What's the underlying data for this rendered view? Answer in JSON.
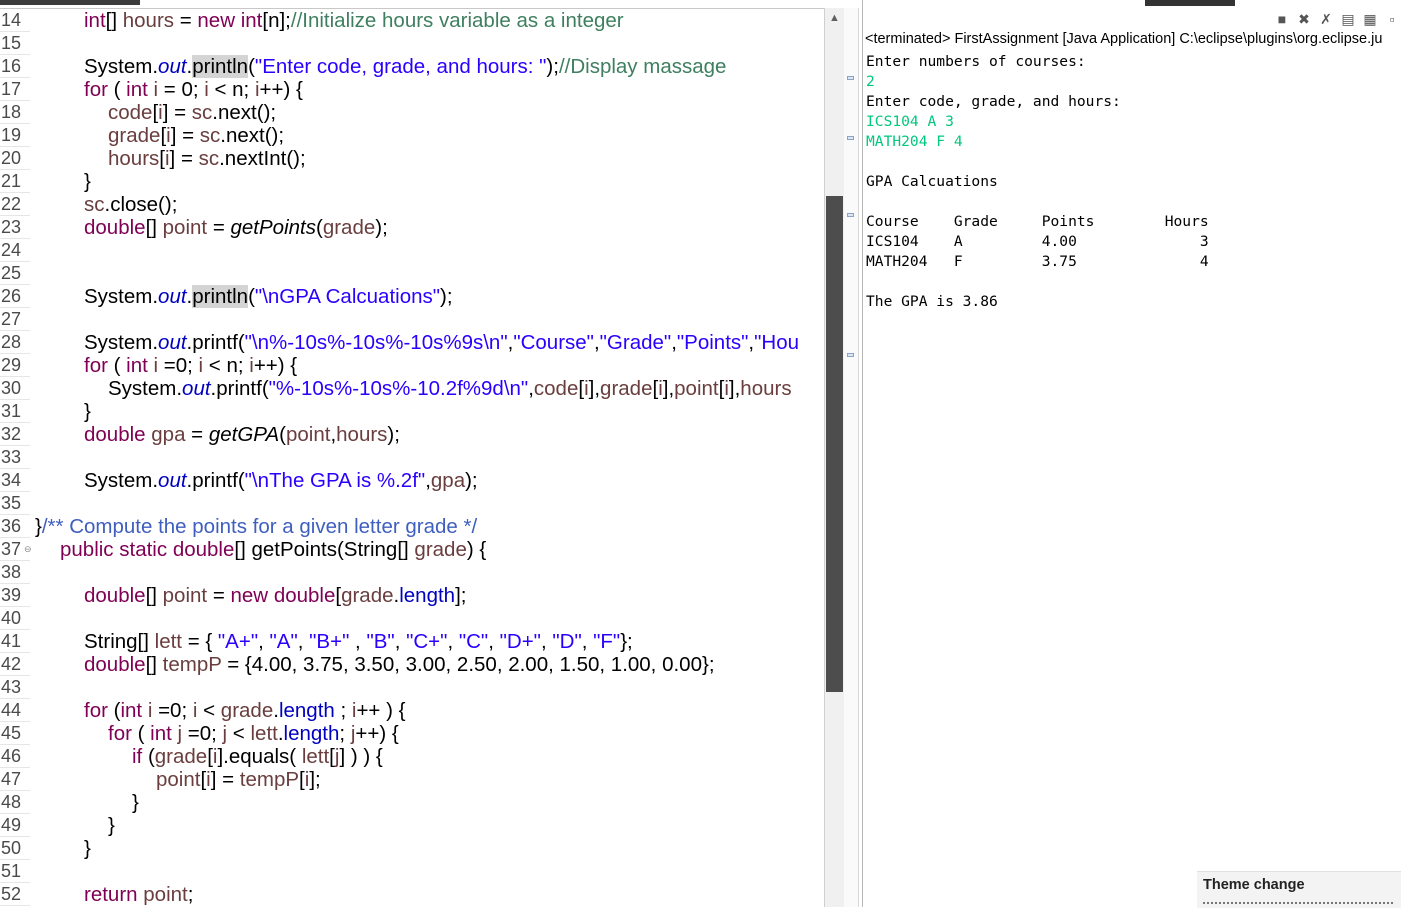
{
  "editor": {
    "lines": [
      {
        "n": "14",
        "code": "<span class=\"kw\">int</span>[] <span class=\"var\">hours</span> = <span class=\"kw\">new</span> <span class=\"kw\">int</span>[n];<span class=\"cm\">//Initialize hours variable as a integer</span>"
      },
      {
        "n": "15",
        "code": ""
      },
      {
        "n": "16",
        "code": "System.<span class=\"st\">out</span>.<span class=\"hl\">println</span>(<span class=\"str\">\"Enter code, grade, and hours: \"</span>);<span class=\"cm\">//Display massage</span>"
      },
      {
        "n": "17",
        "code": "<span class=\"kw\">for</span> ( <span class=\"kw\">int</span> <span class=\"var\">i</span> = 0; <span class=\"var\">i</span> &lt; n; <span class=\"var\">i</span>++) {"
      },
      {
        "n": "18",
        "indent": 1,
        "code": "<span class=\"var\">code</span>[<span class=\"var\">i</span>] = <span class=\"var\">sc</span>.next();"
      },
      {
        "n": "19",
        "indent": 1,
        "code": "<span class=\"var\">grade</span>[<span class=\"var\">i</span>] = <span class=\"var\">sc</span>.next();"
      },
      {
        "n": "20",
        "indent": 1,
        "code": "<span class=\"var\">hours</span>[<span class=\"var\">i</span>] = <span class=\"var\">sc</span>.nextInt();"
      },
      {
        "n": "21",
        "code": "}"
      },
      {
        "n": "22",
        "code": "<span class=\"var\">sc</span>.close();"
      },
      {
        "n": "23",
        "code": "<span class=\"kw\">double</span>[] <span class=\"var\">point</span> = <span class=\"mi\">getPoints</span>(<span class=\"var\">grade</span>);"
      },
      {
        "n": "24",
        "code": ""
      },
      {
        "n": "25",
        "code": ""
      },
      {
        "n": "26",
        "code": "System.<span class=\"st\">out</span>.<span class=\"hl\">println</span>(<span class=\"str\">\"\\nGPA Calcuations\"</span>);"
      },
      {
        "n": "27",
        "code": ""
      },
      {
        "n": "28",
        "code": "System.<span class=\"st\">out</span>.printf(<span class=\"str\">\"\\n%-10s%-10s%-10s%9s\\n\"</span>,<span class=\"str\">\"Course\"</span>,<span class=\"str\">\"Grade\"</span>,<span class=\"str\">\"Points\"</span>,<span class=\"str\">\"Hou</span>"
      },
      {
        "n": "29",
        "code": "<span class=\"kw\">for</span> ( <span class=\"kw\">int</span> <span class=\"var\">i</span> =0; <span class=\"var\">i</span> &lt; n; <span class=\"var\">i</span>++) {"
      },
      {
        "n": "30",
        "indent": 1,
        "code": "System.<span class=\"st\">out</span>.printf(<span class=\"str\">\"%-10s%-10s%-10.2f%9d\\n\"</span>,<span class=\"var\">code</span>[<span class=\"var\">i</span>],<span class=\"var\">grade</span>[<span class=\"var\">i</span>],<span class=\"var\">point</span>[<span class=\"var\">i</span>],<span class=\"var\">hours</span>"
      },
      {
        "n": "31",
        "code": "}"
      },
      {
        "n": "32",
        "code": "<span class=\"kw\">double</span> <span class=\"var\">gpa</span> = <span class=\"mi\">getGPA</span>(<span class=\"var\">point</span>,<span class=\"var\">hours</span>);"
      },
      {
        "n": "33",
        "code": ""
      },
      {
        "n": "34",
        "code": "System.<span class=\"st\">out</span>.printf(<span class=\"str\">\"\\nThe GPA is %.2f\"</span>,<span class=\"var\">gpa</span>);"
      },
      {
        "n": "35",
        "code": ""
      },
      {
        "n": "36",
        "outdent": true,
        "code": "}<span class=\"jd\">/** Compute the points for a given letter grade */</span>"
      },
      {
        "n": "37",
        "fold": true,
        "code": "<span class=\"kw\">public</span> <span class=\"kw\">static</span> <span class=\"kw\">double</span>[] getPoints(String[] <span class=\"var\">grade</span>) {",
        "indent": -1
      },
      {
        "n": "38",
        "code": ""
      },
      {
        "n": "39",
        "code": "<span class=\"kw\">double</span>[] <span class=\"var\">point</span> = <span class=\"kw\">new</span> <span class=\"kw\">double</span>[<span class=\"var\">grade</span>.<span class=\"fld\">length</span>];"
      },
      {
        "n": "40",
        "code": ""
      },
      {
        "n": "41",
        "code": "String[] <span class=\"var\">lett</span> = { <span class=\"str\">\"A+\"</span>, <span class=\"str\">\"A\"</span>, <span class=\"str\">\"B+\"</span> , <span class=\"str\">\"B\"</span>, <span class=\"str\">\"C+\"</span>, <span class=\"str\">\"C\"</span>, <span class=\"str\">\"D+\"</span>, <span class=\"str\">\"D\"</span>, <span class=\"str\">\"F\"</span>};"
      },
      {
        "n": "42",
        "code": "<span class=\"kw\">double</span>[] <span class=\"var\">tempP</span> = {4.00, 3.75, 3.50, 3.00, 2.50, 2.00, 1.50, 1.00, 0.00};"
      },
      {
        "n": "43",
        "code": ""
      },
      {
        "n": "44",
        "code": "<span class=\"kw\">for</span> (<span class=\"kw\">int</span> <span class=\"var\">i</span> =0; <span class=\"var\">i</span> &lt; <span class=\"var\">grade</span>.<span class=\"fld\">length</span> ; <span class=\"var\">i</span>++ ) {"
      },
      {
        "n": "45",
        "indent": 1,
        "code": "<span class=\"kw\">for</span> ( <span class=\"kw\">int</span> <span class=\"var\">j</span> =0; <span class=\"var\">j</span> &lt; <span class=\"var\">lett</span>.<span class=\"fld\">length</span>; <span class=\"var\">j</span>++) {"
      },
      {
        "n": "46",
        "indent": 2,
        "code": "<span class=\"kw\">if</span> (<span class=\"var\">grade</span>[<span class=\"var\">i</span>].equals( <span class=\"var\">lett</span>[<span class=\"var\">j</span>] ) ) {"
      },
      {
        "n": "47",
        "indent": 3,
        "code": "<span class=\"var\">point</span>[<span class=\"var\">i</span>] = <span class=\"var\">tempP</span>[<span class=\"var\">i</span>];"
      },
      {
        "n": "48",
        "indent": 2,
        "code": "}"
      },
      {
        "n": "49",
        "indent": 1,
        "code": "}"
      },
      {
        "n": "50",
        "code": "}"
      },
      {
        "n": "51",
        "code": ""
      },
      {
        "n": "52",
        "code": "<span class=\"kw\">return</span> <span class=\"var\">point</span>;"
      }
    ]
  },
  "console": {
    "title": "<terminated> FirstAssignment [Java Application] C:\\eclipse\\plugins\\org.eclipse.ju",
    "toolbar_icons": [
      "terminate-icon",
      "remove-launch-icon",
      "remove-all-icon",
      "pin-console-icon",
      "display-selected-console-icon",
      "open-console-icon"
    ],
    "output": [
      {
        "text": "Enter numbers of courses:",
        "input": false
      },
      {
        "text": "2",
        "input": true
      },
      {
        "text": "Enter code, grade, and hours:",
        "input": false
      },
      {
        "text": "ICS104 A 3",
        "input": true
      },
      {
        "text": "MATH204 F 4",
        "input": true
      },
      {
        "text": "",
        "input": false
      },
      {
        "text": "GPA Calcuations",
        "input": false
      },
      {
        "text": "",
        "input": false
      },
      {
        "text": "Course    Grade     Points        Hours",
        "input": false
      },
      {
        "text": "ICS104    A         4.00              3",
        "input": false
      },
      {
        "text": "MATH204   F         3.75              4",
        "input": false
      },
      {
        "text": "",
        "input": false
      },
      {
        "text": "The GPA is 3.86",
        "input": false
      }
    ]
  },
  "notification": {
    "title": "Theme change"
  },
  "colors": {
    "keyword": "#7f0055",
    "string": "#2a00ff",
    "comment": "#3f7f5f",
    "javadoc": "#3f5fbf",
    "console_input": "#00c87d"
  }
}
